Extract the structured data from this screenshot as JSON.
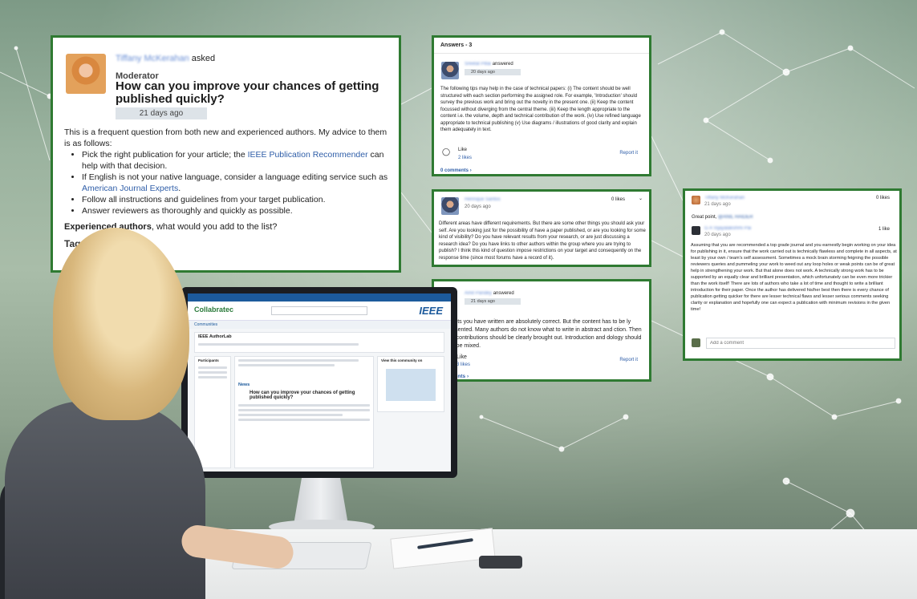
{
  "question": {
    "asker_name": "Tiffany McKerahan",
    "asked_word": "asked",
    "role": "Moderator",
    "title": "How can you improve your chances of getting published quickly?",
    "date": "21 days ago",
    "intro": "This is a frequent question from both new and experienced authors. My advice to them is as follows:",
    "bullet1_text": "Pick the right publication for your article; the ",
    "bullet1_link": "IEEE Publication Recommender",
    "bullet1_tail": " can help with that decision.",
    "bullet2_text": "If English is not your native language, consider a language editing service such as ",
    "bullet2_link": "American Journal Experts",
    "bullet2_tail": ".",
    "bullet3": "Follow all instructions and guidelines from your target publication.",
    "bullet4": "Answer reviewers as thoroughly and quickly as possible.",
    "closing_bold": "Experienced authors",
    "closing_rest": ", what would you add to the list?",
    "tags_label": "Tags"
  },
  "answers": {
    "header": "Answers - 3",
    "a1": {
      "name": "Sreelal Pillai",
      "verb": "answered",
      "date": "20 days ago",
      "text": "The following tips may help in the case of technical papers: (i) The content should be well structured with each section performing the assigned role. For example, 'Introduction' should survey the previous work and bring out the novelty in the present one. (ii) Keep the content focussed without diverging from the central theme. (iii) Keep the length appropriate to the content i.e. the volume, depth and technical contribution of the work. (iv) Use refined language appropriate to technical publishing (v) Use diagrams / illustrations of good clarity and explain them adequately in text.",
      "like": "Like",
      "likes": "2 likes",
      "report": "Report it",
      "comments": "0 comments"
    },
    "a2": {
      "name": "Henrique Santos",
      "date": "20 days ago",
      "likes": "0 likes",
      "text": "Different areas have different requirements. But there are some other things you should ask your self. Are you looking just for the possibility of have a paper published, or are you looking for some kind of visibility? Do you have relevant results from your research, or are just discussing a research idea? Do you have links to other authors within the group where you are trying to publish? I think this kind of question impose restrictions on your target and consequently on the response time (since most forums have a record of it)."
    },
    "a3": {
      "name": "Amit Pandey",
      "verb": "answered",
      "date": "21 days ago",
      "text": "points you have written are absolutely correct. But the content has to be ly presented. Many authors do not know what to write in abstract and ction. Then the contributions should be clearly brought out. Introduction and dology should not be mixed.",
      "like": "Like",
      "likes": "3 likes",
      "report": "Report it",
      "comments": "ments"
    }
  },
  "comment_thread": {
    "poster": "Tiffany McKerahan",
    "poster_date": "21 days ago",
    "poster_likes": "0 likes",
    "greeting": "Great point,",
    "mention": "@ANIL HAIDER",
    "replier": "G A Vijayalakshmi Pai",
    "replier_date": "20 days ago",
    "replier_likes": "1 like",
    "text": "Assuming that you are recommended a top grade journal and you earnestly begin working on your idea for publishing in it, ensure that the work carried out is technically flawless and complete in all aspects, at least by your own / team's self assessment. Sometimes a mock brain storming feigning the possible reviewers queries and pummeling your work to weed out any loop holes or weak points can be of great help in strengthening your work. But that alone does not work. A technically strong work has to be supported by an equally clear and brilliant presentation, which unfortunately can be even more trickier than the work itself! There are lots of authors who take a lot of time and thought to write a brilliant introduction for their paper. Once the author has delivered his/her best then there is every chance of publication getting quicker for there are lesser technical flaws and lesser serious comments seeking clarity or explanation and hopefully one can expect a publication with minimum revisions in the given time!",
    "add_comment_placeholder": "Add a comment"
  },
  "monitor_ui": {
    "brand": "Collabratec",
    "org": "IEEE",
    "nav": "Communities",
    "community": "IEEE AuthorLab",
    "question_title": "How can you improve your chances of getting published quickly?",
    "view_label": "View this community on",
    "news": "News",
    "participants": "Participants"
  },
  "colors": {
    "card_border": "#2f7a32",
    "link": "#2f5ea8",
    "ieee_blue": "#1c5a9c"
  }
}
